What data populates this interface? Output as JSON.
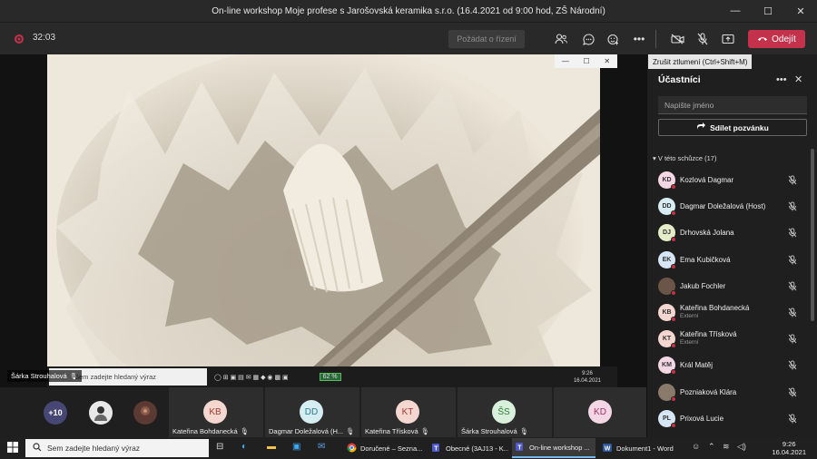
{
  "window": {
    "title": "On-line workshop Moje profese s Jarošovská keramika s.r.o. (16.4.2021 od 9:00 hod, ZŠ Národní)",
    "minimize": "—",
    "maximize": "☐",
    "close": "✕"
  },
  "toolbar": {
    "timer": "32:03",
    "request_control": "Požádat o řízení",
    "leave": "Odejít",
    "tooltip": "Zrušit ztlumení (Ctrl+Shift+M)"
  },
  "stage": {
    "presenter_name": "Šárka Strouhalová",
    "shared_search_placeholder": "Sem zadejte hledaný výraz",
    "shared_time": "9:26",
    "shared_date": "16.04.2021",
    "shared_battery": "62 %",
    "mini_ctrls": [
      "—",
      "☐",
      "✕"
    ]
  },
  "strip": {
    "more_count": "+10",
    "tiles": [
      {
        "initials": "KB",
        "name": "Kateřina Bohdanecká",
        "bg": "#f4d7d0",
        "fg": "#a33a2e"
      },
      {
        "initials": "DD",
        "name": "Dagmar Doležalová (H...",
        "bg": "#d6eef2",
        "fg": "#2a7d8c"
      },
      {
        "initials": "KT",
        "name": "Kateřina Třísková",
        "bg": "#f4d7d0",
        "fg": "#a33a2e"
      },
      {
        "initials": "ŠS",
        "name": "Šárka Strouhalová",
        "bg": "#d8f0dc",
        "fg": "#2f7d3a"
      },
      {
        "initials": "KD",
        "name": "",
        "bg": "#f4d7e4",
        "fg": "#a3336a"
      }
    ]
  },
  "panel": {
    "title": "Účastníci",
    "search_placeholder": "Napište jméno",
    "share_invite": "Sdílet pozvánku",
    "section": "V této schůzce (17)",
    "participants": [
      {
        "initials": "KD",
        "name": "Kozlová Dagmar",
        "sub": "",
        "bg": "#f4d7e4"
      },
      {
        "initials": "DD",
        "name": "Dagmar Doležalová (Host)",
        "sub": "",
        "bg": "#d6eef2"
      },
      {
        "initials": "DJ",
        "name": "Drhovská Jolana",
        "sub": "",
        "bg": "#e5edc8"
      },
      {
        "initials": "EK",
        "name": "Ema Kubičková",
        "sub": "",
        "bg": "#d6e6f4"
      },
      {
        "initials": "",
        "name": "Jakub Fochler",
        "sub": "",
        "bg": "#6b5548"
      },
      {
        "initials": "KB",
        "name": "Kateřina Bohdanecká",
        "sub": "Externí",
        "bg": "#f4d7d0"
      },
      {
        "initials": "KT",
        "name": "Kateřina Třísková",
        "sub": "Externí",
        "bg": "#f4d7d0"
      },
      {
        "initials": "KM",
        "name": "Král Matěj",
        "sub": "",
        "bg": "#f4d7e4"
      },
      {
        "initials": "",
        "name": "Pozniaková Klára",
        "sub": "",
        "bg": "#8a7a6a"
      },
      {
        "initials": "PL",
        "name": "Prixová Lucie",
        "sub": "",
        "bg": "#d6e6f4"
      }
    ]
  },
  "taskbar": {
    "search_placeholder": "Sem zadejte hledaný výraz",
    "apps": [
      {
        "label": "Doručené – Sezna...",
        "icon": "chrome-icon"
      },
      {
        "label": "Obecné (3AJ13 - K...",
        "icon": "teams-icon"
      },
      {
        "label": "On-line workshop ...",
        "icon": "teams-icon"
      },
      {
        "label": "Dokument1 - Word",
        "icon": "word-icon"
      }
    ],
    "time": "9:26",
    "date": "16.04.2021"
  }
}
